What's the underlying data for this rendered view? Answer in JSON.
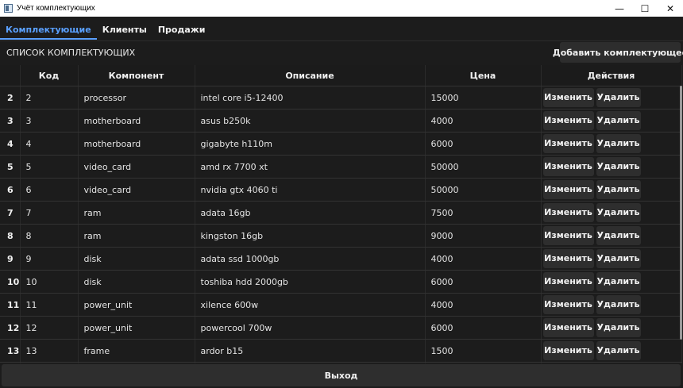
{
  "window": {
    "title": "Учёт комплектующих",
    "minimize": "—",
    "maximize": "☐",
    "close": "✕"
  },
  "tabs": [
    {
      "label": "Комплектующие",
      "active": true
    },
    {
      "label": "Клиенты",
      "active": false
    },
    {
      "label": "Продажи",
      "active": false
    }
  ],
  "list_title": "СПИСОК КОМПЛЕКТУЮЩИХ",
  "add_button": "Добавить комплектующее",
  "table": {
    "columns": [
      "",
      "Код",
      "Компонент",
      "Описание",
      "Цена",
      "Действия"
    ],
    "edit_label": "Изменить",
    "delete_label": "Удалить",
    "rows": [
      {
        "num": "2",
        "code": "2",
        "component": "processor",
        "description": "intel core i5-12400",
        "price": "15000"
      },
      {
        "num": "3",
        "code": "3",
        "component": "motherboard",
        "description": "asus b250k",
        "price": "4000"
      },
      {
        "num": "4",
        "code": "4",
        "component": "motherboard",
        "description": "gigabyte h110m",
        "price": "6000"
      },
      {
        "num": "5",
        "code": "5",
        "component": "video_card",
        "description": "amd rx 7700 xt",
        "price": "50000"
      },
      {
        "num": "6",
        "code": "6",
        "component": "video_card",
        "description": "nvidia gtx 4060 ti",
        "price": "50000"
      },
      {
        "num": "7",
        "code": "7",
        "component": "ram",
        "description": "adata 16gb",
        "price": "7500"
      },
      {
        "num": "8",
        "code": "8",
        "component": "ram",
        "description": "kingston 16gb",
        "price": "9000"
      },
      {
        "num": "9",
        "code": "9",
        "component": "disk",
        "description": "adata ssd 1000gb",
        "price": "4000"
      },
      {
        "num": "10",
        "code": "10",
        "component": "disk",
        "description": "toshiba hdd 2000gb",
        "price": "6000"
      },
      {
        "num": "11",
        "code": "11",
        "component": "power_unit",
        "description": "xilence 600w",
        "price": "4000"
      },
      {
        "num": "12",
        "code": "12",
        "component": "power_unit",
        "description": "powercool 700w",
        "price": "6000"
      },
      {
        "num": "13",
        "code": "13",
        "component": "frame",
        "description": "ardor b15",
        "price": "1500"
      }
    ]
  },
  "exit_button": "Выход"
}
